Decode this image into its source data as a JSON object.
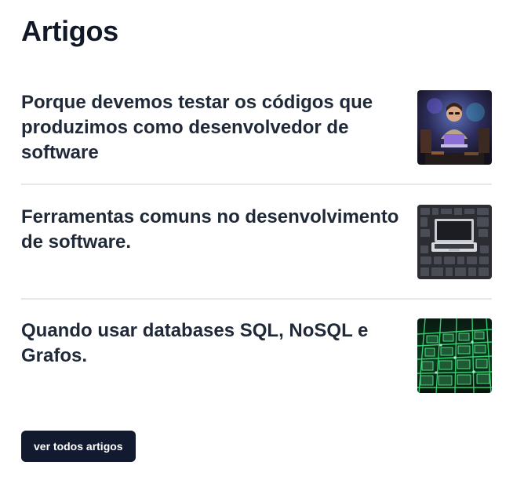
{
  "section": {
    "title": "Artigos"
  },
  "articles": [
    {
      "title": "Porque devemos testar os códigos que produzimos como desenvolvedor de software",
      "image": "person-coding-laptop-thumbnail"
    },
    {
      "title": "Ferramentas comuns no desenvolvimento de software.",
      "image": "laptop-tools-flatlay-thumbnail"
    },
    {
      "title": "Quando usar databases SQL, NoSQL e Grafos.",
      "image": "green-circuit-board-thumbnail"
    }
  ],
  "cta": {
    "label": "ver todos artigos"
  },
  "colors": {
    "text": "#111827",
    "divider": "#e5e7eb",
    "button_bg": "#111a2e",
    "button_text": "#ffffff"
  }
}
